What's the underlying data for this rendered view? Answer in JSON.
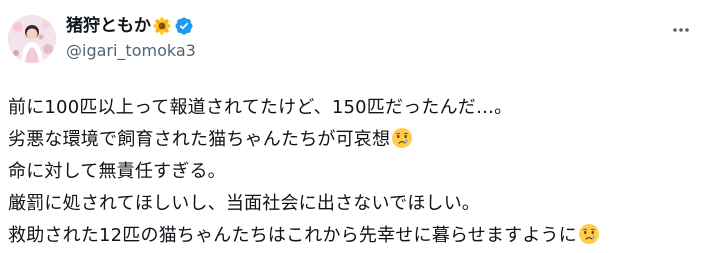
{
  "post": {
    "author": {
      "display_name": "猪狩ともか",
      "name_emoji": "sunflower-icon",
      "verified_badge": "verified-badge-icon",
      "handle": "@igari_tomoka3",
      "avatar": "avatar"
    },
    "more_menu_icon": "more-options-icon",
    "lines": [
      {
        "text": "前に100匹以上って報道されてたけど、150匹だったんだ…。",
        "emoji": ""
      },
      {
        "text": "劣悪な環境で飼育された猫ちゃんたちが可哀想",
        "emoji": "crying-face-icon"
      },
      {
        "text": "命に対して無責任すぎる。",
        "emoji": ""
      },
      {
        "text": "厳罰に処されてほしいし、当面社会に出さないでほしい。",
        "emoji": ""
      },
      {
        "text": "救助された12匹の猫ちゃんたちはこれから先幸せに暮らせますように",
        "emoji": "crying-face-icon"
      }
    ]
  },
  "colors": {
    "text_primary": "#0f1419",
    "text_secondary": "#536471",
    "verified_blue": "#1d9bf0",
    "background": "#ffffff"
  }
}
